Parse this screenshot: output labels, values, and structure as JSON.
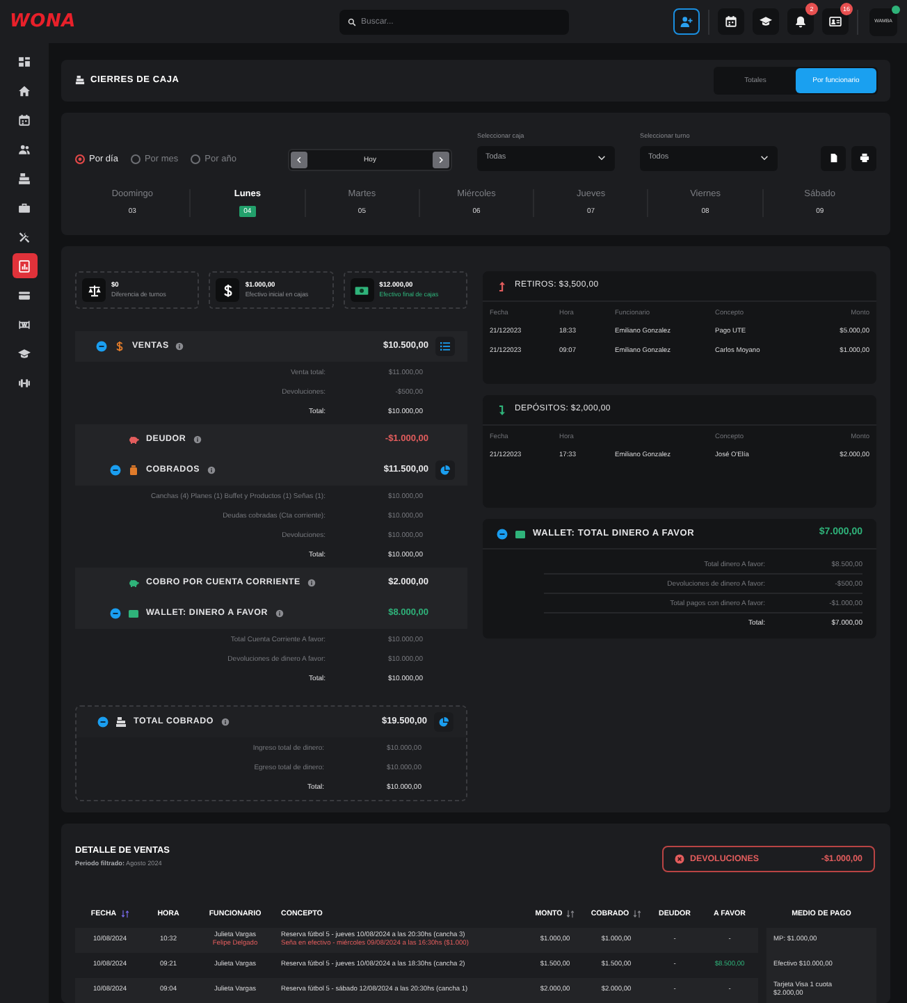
{
  "brand": {
    "logo": "WONA"
  },
  "search": {
    "placeholder": "Buscar..."
  },
  "topbar_buttons": [
    {
      "highlighted": true
    },
    {
      "highlighted": false
    },
    {
      "highlighted": false
    },
    {
      "highlighted": false,
      "badge": "2"
    },
    {
      "highlighted": false,
      "badge": "16"
    }
  ],
  "user": {
    "avatar_label": "WAMBA",
    "online": true
  },
  "sidebar": {
    "items": [
      {
        "selected": false
      },
      {
        "selected": false
      },
      {
        "selected": false
      },
      {
        "selected": false
      },
      {
        "selected": false
      },
      {
        "selected": false
      },
      {
        "selected": false
      },
      {
        "selected": true
      },
      {
        "selected": false
      },
      {
        "selected": false
      },
      {
        "selected": false
      },
      {
        "selected": false
      }
    ]
  },
  "header": {
    "title": "CIERRES DE CAJA",
    "views": [
      {
        "label": "Totales",
        "selected": false
      },
      {
        "label": "Por funcionario",
        "selected": true
      }
    ]
  },
  "filters": {
    "periods": [
      {
        "label": "Por día",
        "selected": true
      },
      {
        "label": "Por mes",
        "selected": false
      },
      {
        "label": "Por año",
        "selected": false
      }
    ],
    "date_nav": {
      "label": "Hoy"
    },
    "selects": [
      {
        "label": "Seleccionar caja",
        "value": "Todas"
      },
      {
        "label": "Seleccionar turno",
        "value": "Todos"
      }
    ]
  },
  "days": [
    {
      "name": "Doomingo",
      "date": "03",
      "selected": false
    },
    {
      "name": "Lunes",
      "date": "04",
      "selected": true
    },
    {
      "name": "Martes",
      "date": "05",
      "selected": false
    },
    {
      "name": "Miércoles",
      "date": "06",
      "selected": false
    },
    {
      "name": "Jueves",
      "date": "07",
      "selected": false
    },
    {
      "name": "Viernes",
      "date": "08",
      "selected": false
    },
    {
      "name": "Sábado",
      "date": "09",
      "selected": false
    }
  ],
  "summary_cards": [
    {
      "value": "$0",
      "label": "Diferencia de turnos",
      "kind": "plain"
    },
    {
      "value": "$1.000,00",
      "label": "Efectivo inicial en cajas",
      "kind": "plain"
    },
    {
      "value": "$12.000,00",
      "label": "Efectivo final de cajas",
      "kind": "positive"
    }
  ],
  "sections": [
    {
      "title": "VENTAS",
      "amount": "$10.500,00",
      "color": "#e8e8ea",
      "expanded": true,
      "lines": [
        {
          "label": "Venta total:",
          "value": "$11.000,00",
          "kind": "line"
        },
        {
          "label": "Devoluciones:",
          "value": "-$500,00",
          "kind": "line"
        },
        {
          "label": "Total:",
          "value": "$10.000,00",
          "kind": "total"
        }
      ],
      "children": [
        {
          "title": "DEUDOR",
          "amount": "-$1.000,00",
          "color": "#e35d5d"
        },
        {
          "title": "COBRADOS",
          "amount": "$11.500,00",
          "color": "#e8e8ea",
          "expanded": true,
          "lines": [
            {
              "label": "Canchas (4) Planes (1) Buffet y Productos (1) Señas (1):",
              "value": "$10.000,00",
              "kind": "line"
            },
            {
              "label": "Deudas cobradas (Cta corriente):",
              "value": "$10.000,00",
              "kind": "line"
            },
            {
              "label": "Devoluciones:",
              "value": "$10.000,00",
              "kind": "line"
            },
            {
              "label": "Total:",
              "value": "$10.000,00",
              "kind": "total"
            }
          ]
        },
        {
          "title": "COBRO POR CUENTA CORRIENTE",
          "amount": "$2.000,00",
          "color": "#e8e8ea"
        },
        {
          "title": "WALLET: DINERO A FAVOR",
          "amount": "$8.000,00",
          "color": "#2fb37a",
          "expanded": true,
          "lines": [
            {
              "label": "Total Cuenta Corriente A favor:",
              "value": "$10.000,00",
              "kind": "line"
            },
            {
              "label": "Devoluciones de dinero A favor:",
              "value": "$10.000,00",
              "kind": "line"
            },
            {
              "label": "Total:",
              "value": "$10.000,00",
              "kind": "total"
            }
          ]
        }
      ]
    }
  ],
  "total_cobrado": {
    "title": "TOTAL COBRADO",
    "amount": "$19.500,00",
    "color": "#e8e8ea",
    "expanded": true,
    "lines": [
      {
        "label": "Ingreso total de dinero:",
        "value": "$10.000,00",
        "kind": "line"
      },
      {
        "label": "Egreso total de dinero:",
        "value": "$10.000,00",
        "kind": "line"
      },
      {
        "label": "Total:",
        "value": "$10.000,00",
        "kind": "total"
      }
    ]
  },
  "movements": [
    {
      "kind": "withdrawal",
      "title": "RETIROS: $3,500,00",
      "columns": [
        {
          "label": "Fecha"
        },
        {
          "label": "Hora"
        },
        {
          "label": "Funcionario"
        },
        {
          "label": "Concepto"
        },
        {
          "label": "Monto"
        }
      ],
      "rows": [
        [
          "21/122023",
          "18:33",
          "Emiliano Gonzalez",
          "Pago UTE",
          "$5.000,00"
        ],
        [
          "21/122023",
          "09:07",
          "Emiliano Gonzalez",
          "Carlos Moyano",
          "$1.000,00"
        ]
      ]
    },
    {
      "kind": "deposit",
      "title": "DEPÓSITOS: $2,000,00",
      "columns": [
        {
          "label": "Fecha"
        },
        {
          "label": "Hora"
        },
        {},
        {
          "label": "Concepto"
        },
        {
          "label": "Monto"
        }
      ],
      "rows": [
        [
          "21/122023",
          "17:33",
          "Emiliano Gonzalez",
          "José O'Elía",
          "$2.000,00"
        ]
      ]
    }
  ],
  "wallet_total": {
    "title": "WALLET: TOTAL DINERO A FAVOR",
    "amount": "$7.000,00",
    "color": "#2fb37a",
    "expanded": true,
    "lines": [
      {
        "label": "Total dinero A favor:",
        "value": "$8.500,00",
        "kind": "line"
      },
      {
        "label": "Devoluciones de dinero A favor:",
        "value": "-$500,00",
        "kind": "line"
      },
      {
        "label": "Total pagos con dinero A favor:",
        "value": "-$1.000,00",
        "kind": "line"
      },
      {
        "label": "Total:",
        "value": "$7.000,00",
        "kind": "total"
      }
    ]
  },
  "sales_detail": {
    "title": "DETALLE DE VENTAS",
    "period": "**Periodo filtrado:** Agosto 2024",
    "returns": {
      "label": "DEVOLUCIONES",
      "amount": "-$1.000,00"
    },
    "columns": [
      {
        "label": "FECHA",
        "sorted": true
      },
      {
        "label": "HORA"
      },
      {
        "label": "FUNCIONARIO"
      },
      {
        "label": "CONCEPTO"
      },
      {
        "label": "MONTO",
        "sorted": false
      },
      {
        "label": "COBRADO",
        "sorted": false
      },
      {
        "label": "DEUDOR"
      },
      {
        "label": "A FAVOR"
      },
      {
        "label": "MEDIO DE PAGO"
      }
    ],
    "rows": [
      {
        "fecha": "10/08/2024",
        "hora": "10:32",
        "funcionario": [
          {
            "text": "Julieta Vargas",
            "kind": "plain"
          },
          {
            "text": "Felipe Delgado",
            "kind": "alert"
          }
        ],
        "concepto": [
          {
            "text": "Reserva fútbol 5 - jueves 10/08/2024 a las 20:30hs (cancha 3)",
            "kind": "plain"
          },
          {
            "text": "Seña en efectivo - miércoles 09/08/2024 a las 16:30hs ($1.000)",
            "kind": "alert"
          }
        ],
        "monto": "$1.000,00",
        "cobrado": "$1.000,00",
        "deudor": "-",
        "a_favor": {
          "text": "-",
          "kind": "plain"
        },
        "medio_pago": "MP: $1.000,00"
      },
      {
        "fecha": "10/08/2024",
        "hora": "09:21",
        "funcionario": [
          {
            "text": "Julieta Vargas",
            "kind": "plain"
          }
        ],
        "concepto": [
          {
            "text": "Reserva fútbol 5 - jueves 10/08/2024 a las 18:30hs (cancha 2)",
            "kind": "plain"
          }
        ],
        "monto": "$1.500,00",
        "cobrado": "$1.500,00",
        "deudor": "-",
        "a_favor": {
          "text": "$8.500,00",
          "kind": "positive"
        },
        "medio_pago": "Efectivo $10.000,00"
      },
      {
        "fecha": "10/08/2024",
        "hora": "09:04",
        "funcionario": [
          {
            "text": "Julieta Vargas",
            "kind": "plain"
          }
        ],
        "concepto": [
          {
            "text": "Reserva fútbol 5 - sábado 12/08/2024 a las 20:30hs (cancha 1)",
            "kind": "plain"
          }
        ],
        "monto": "$2.000,00",
        "cobrado": "$2.000,00",
        "deudor": "-",
        "a_favor": {
          "text": "-",
          "kind": "plain"
        },
        "medio_pago": "Tarjeta Visa 1 cuota $2.000,00"
      }
    ]
  }
}
